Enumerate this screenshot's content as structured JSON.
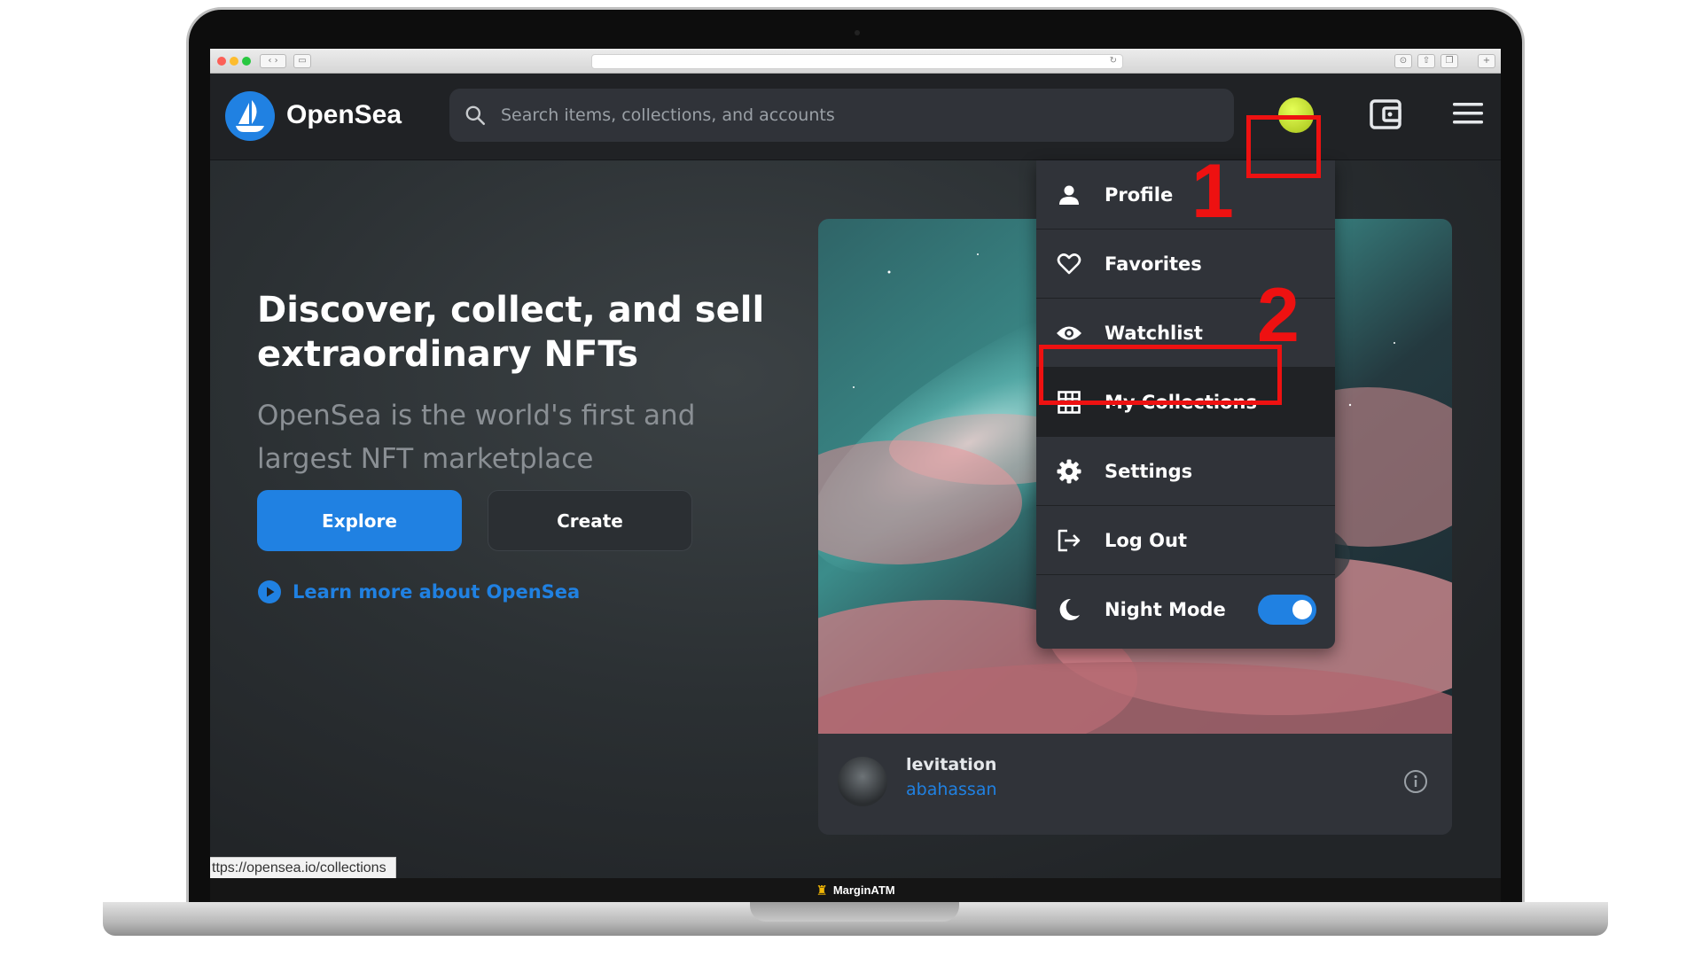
{
  "browser": {
    "status_url": "ttps://opensea.io/collections"
  },
  "nav": {
    "logo_text": "OpenSea",
    "search_placeholder": "Search items, collections, and accounts",
    "icons": [
      "search-icon",
      "avatar",
      "wallet-icon",
      "menu-icon"
    ]
  },
  "annotations": {
    "step1": "1",
    "step2": "2",
    "color": "#ee1111"
  },
  "hero": {
    "headline": "Discover, collect, and sell extraordinary NFTs",
    "subline": "OpenSea is the world's first and largest NFT marketplace",
    "explore_label": "Explore",
    "create_label": "Create",
    "learn_more": "Learn more about OpenSea"
  },
  "featured": {
    "name": "levitation",
    "creator": "abahassan"
  },
  "menu": {
    "items": [
      {
        "label": "Profile",
        "icon": "person-icon"
      },
      {
        "label": "Favorites",
        "icon": "heart-icon"
      },
      {
        "label": "Watchlist",
        "icon": "eye-icon"
      },
      {
        "label": "My Collections",
        "icon": "grid-icon"
      },
      {
        "label": "Settings",
        "icon": "gear-icon"
      },
      {
        "label": "Log Out",
        "icon": "logout-icon"
      },
      {
        "label": "Night Mode",
        "icon": "moon-icon"
      }
    ],
    "night_mode_on": true
  },
  "footer": {
    "brand": "MarginATM"
  },
  "colors": {
    "accent": "#2081e2",
    "background": "#202225",
    "panel": "#303339",
    "avatar": "#c8e63a"
  }
}
